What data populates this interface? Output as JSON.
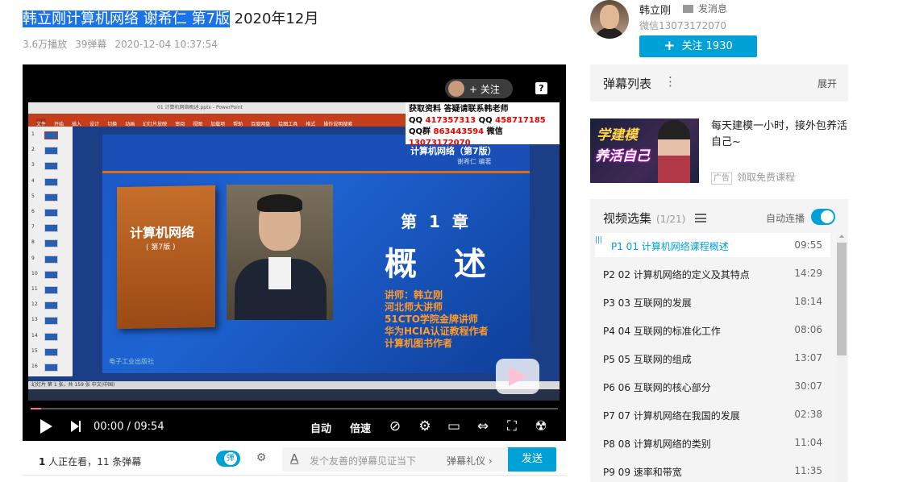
{
  "video": {
    "title_highlight": "韩立刚计算机网络 谢希仁 第7版",
    "title_rest": " 2020年12月",
    "plays": "3.6万播放",
    "danmaku_count": "39弹幕",
    "pubdate": "2020-12-04 10:37:54"
  },
  "player": {
    "follow_label": "+ 关注",
    "help_icon": "?",
    "time_current": "00:00",
    "time_sep": " / ",
    "time_total": "09:54",
    "progress": 0.02,
    "quality_label": "自动",
    "speed_label": "倍速"
  },
  "slide": {
    "ppt_window_title": "01 计算机网络概述.pptx - PowerPoint",
    "ribbon_tabs": [
      "文件",
      "开始",
      "插入",
      "设计",
      "切换",
      "动画",
      "幻灯片放映",
      "审阅",
      "视图",
      "加载项",
      "帮助",
      "百度网盘",
      "绘图工具",
      "格式",
      "操作说明搜索"
    ],
    "thumb_numbers": [
      "1",
      "2",
      "3",
      "4",
      "5",
      "6",
      "7",
      "8",
      "9",
      "10",
      "11",
      "12",
      "13",
      "14",
      "15",
      "16"
    ],
    "header_title": "计算机网络（第7版）",
    "header_author": "谢希仁  编著",
    "book_title": "计算机网络",
    "book_edition": "( 第7版 )",
    "chapter": "第 1 章",
    "chapter_title": "概  述",
    "lecturer_lines": [
      "讲师：韩立刚",
      "河北师大讲师",
      "51CTO学院金牌讲师",
      "华为HCIA认证教程作者",
      "计算机图书作者"
    ],
    "publisher": "电子工业出版社",
    "contact_line1": "获取资料 答疑请联系韩老师",
    "contact_qq_label": "QQ",
    "contact_qq1": "417357313",
    "contact_qq2": "458717185",
    "contact_group_label": "QQ群",
    "contact_group": "863443594",
    "contact_wechat_label": "微信",
    "contact_wechat": "13073172070",
    "status_bar": "幻灯片 第 1 张，共 159 张    中文(中国)"
  },
  "bottom_bar": {
    "watching_count": "1",
    "watching_text": " 人正在看，",
    "danmaku_num": "11",
    "danmaku_text": " 条弹幕",
    "toggle_label": "弹",
    "input_placeholder": "发个友善的弹幕见证当下",
    "gift_label": "弹幕礼仪",
    "send_label": "发送"
  },
  "uploader": {
    "name": "韩立刚",
    "message_label": "发消息",
    "desc": "微信13073172070",
    "follow_label": "关注 1930"
  },
  "danmaku_list": {
    "title": "弹幕列表",
    "expand": "展开"
  },
  "ad": {
    "image_line1": "学建模",
    "image_line2": "养活自己",
    "text": "每天建模一小时，接外包养活自己~",
    "tag": "广告",
    "link": "领取免费课程"
  },
  "episodes": {
    "title": "视频选集",
    "count": "(1/21)",
    "autoplay_label": "自动连播",
    "items": [
      {
        "label": "P1  01 计算机网络课程概述",
        "duration": "09:55"
      },
      {
        "label": "P2  02 计算机网络的定义及其特点",
        "duration": "14:29"
      },
      {
        "label": "P3  03 互联网的发展",
        "duration": "18:14"
      },
      {
        "label": "P4  04 互联网的标准化工作",
        "duration": "08:06"
      },
      {
        "label": "P5  05 互联网的组成",
        "duration": "13:07"
      },
      {
        "label": "P6  06 互联网的核心部分",
        "duration": "30:07"
      },
      {
        "label": "P7  07 计算机网络在我国的发展",
        "duration": "02:38"
      },
      {
        "label": "P8  08 计算机网络的类别",
        "duration": "11:04"
      },
      {
        "label": "P9  09 速率和带宽",
        "duration": "11:35"
      }
    ]
  },
  "colors": {
    "accent": "#00a1d6",
    "title_highlight_bg": "#1a73e8",
    "ppt_ribbon": "#c43e1c",
    "progress": "#fb7299"
  }
}
